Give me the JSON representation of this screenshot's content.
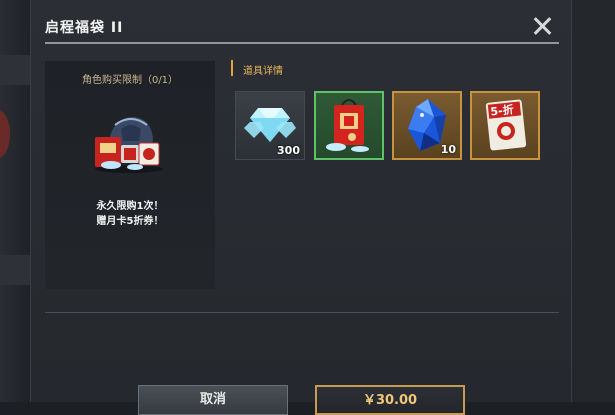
{
  "dialog": {
    "title": "启程福袋 II",
    "close_icon": "close-icon"
  },
  "left_panel": {
    "limit_text": "角色购买限制（0/1）",
    "promo_line1": "永久限购1次！",
    "promo_line2": "赠月卡5折券！",
    "bag_icon": "lucky-bag-icon"
  },
  "details": {
    "header": "道具详情",
    "items": [
      {
        "icon": "diamond-icon",
        "count": "300",
        "rarity_color": "#454a51"
      },
      {
        "icon": "lucky-bag-icon",
        "count": "",
        "rarity_color": "#5dc26a"
      },
      {
        "icon": "blue-crystal-icon",
        "count": "10",
        "rarity_color": "#c7933f"
      },
      {
        "icon": "discount-coupon-icon",
        "count": "",
        "rarity_color": "#c7933f"
      }
    ]
  },
  "buttons": {
    "cancel_label": "取消",
    "buy_label": "￥30.00"
  }
}
